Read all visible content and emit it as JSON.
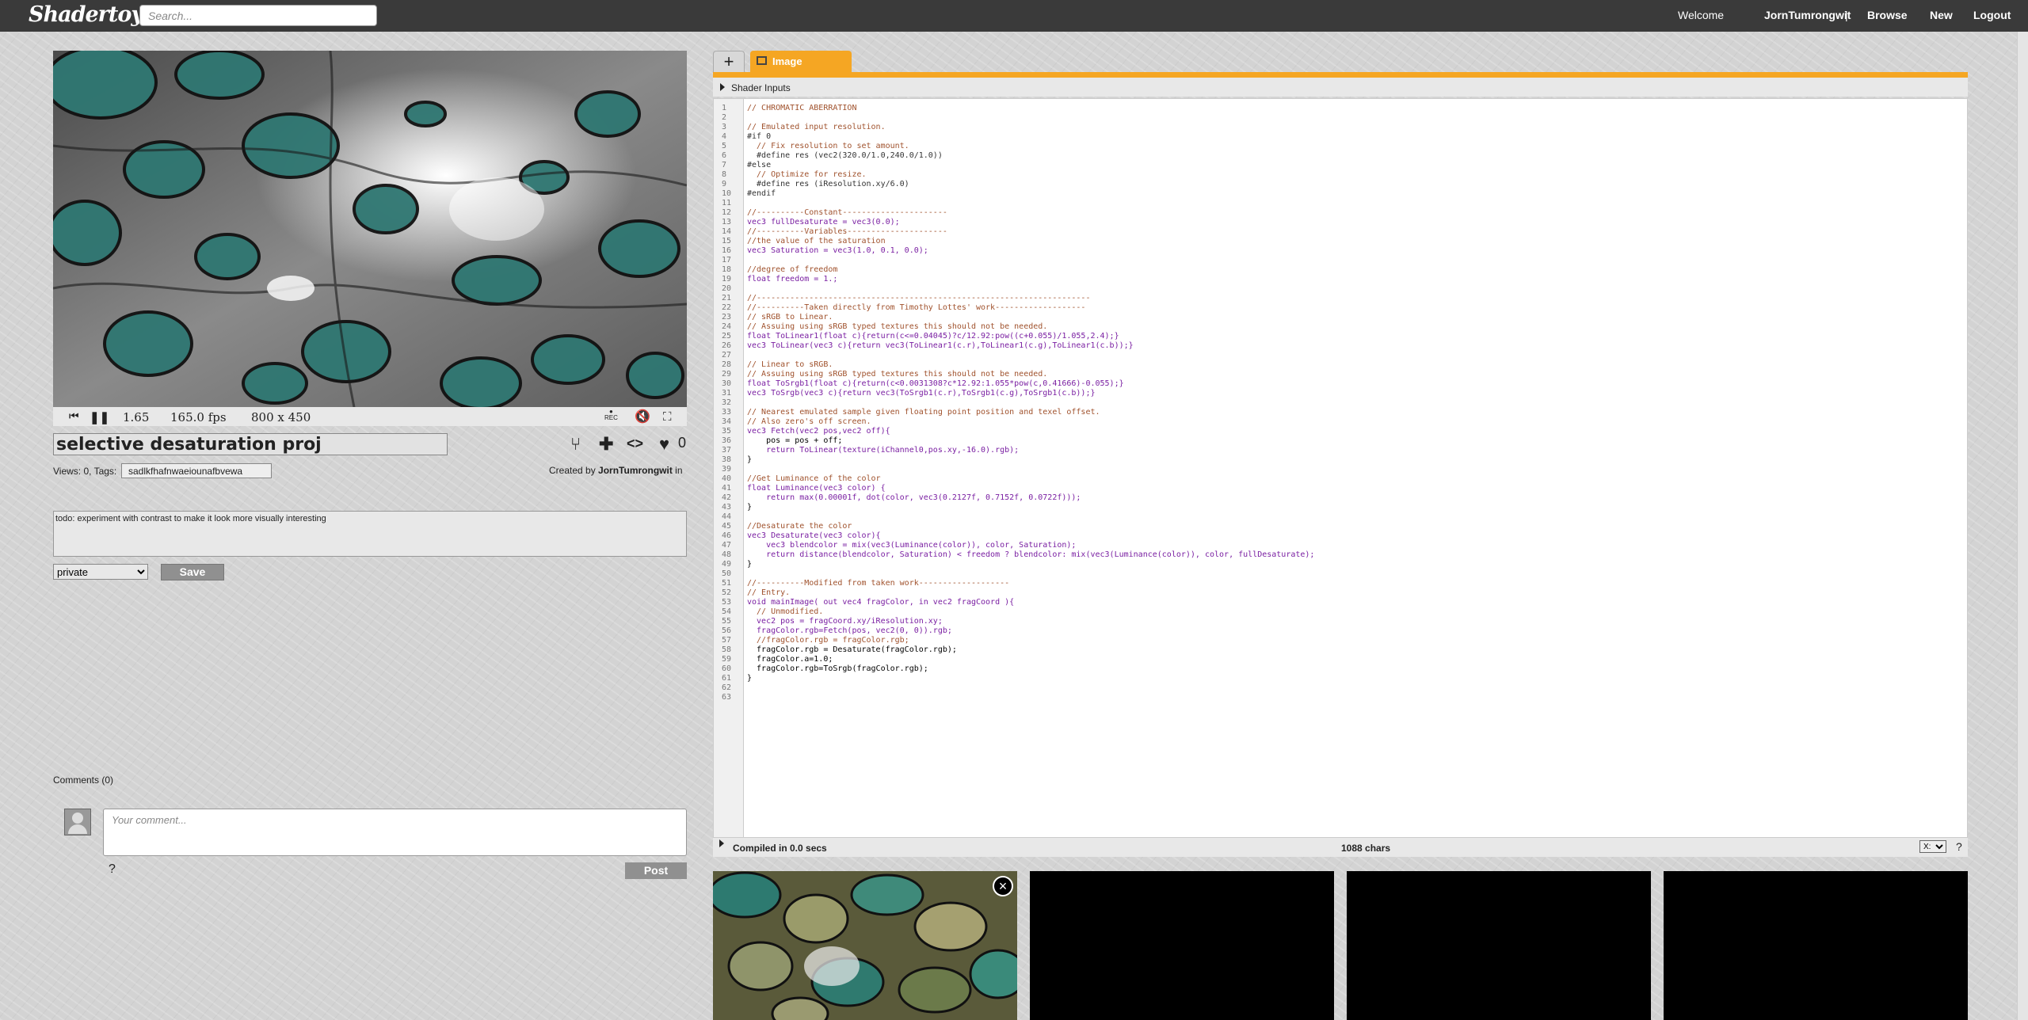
{
  "header": {
    "logo": "Shadertoy",
    "search_placeholder": "Search...",
    "welcome": "Welcome",
    "username": "JornTumrongwit",
    "separator": "|",
    "browse": "Browse",
    "new": "New",
    "logout": "Logout"
  },
  "player": {
    "time": "1.65",
    "fps": "165.0 fps",
    "resolution": "800 x 450",
    "rec_label": "REC"
  },
  "shader": {
    "title": "selective desaturation proj",
    "likes": "0",
    "views": "Views: 0, Tags:",
    "tags": "sadlkfhafnwaeiounafbvewa",
    "created_by": "Created by",
    "author": "JornTumrongwit",
    "in": "in",
    "description": "todo: experiment with contrast to make it look more visually interesting",
    "privacy": "private",
    "privacy_options": [
      "private"
    ],
    "save": "Save"
  },
  "comments": {
    "label": "Comments (0)",
    "placeholder": "Your comment...",
    "help": "?",
    "post": "Post"
  },
  "editor": {
    "add_tab": "+",
    "tab_image": "Image",
    "shader_inputs": "Shader Inputs",
    "status": "Compiled in 0.0 secs",
    "chars": "1088 chars",
    "select_value": "X:",
    "help": "?",
    "lines": [
      "// CHROMATIC ABERRATION",
      "",
      "// Emulated input resolution.",
      "#if 0",
      "  // Fix resolution to set amount.",
      "  #define res (vec2(320.0/1.0,240.0/1.0))",
      "#else",
      "  // Optimize for resize.",
      "  #define res (iResolution.xy/6.0)",
      "#endif",
      "",
      "//----------Constant----------------------",
      "vec3 fullDesaturate = vec3(0.0);",
      "//----------Variables---------------------",
      "//the value of the saturation",
      "vec3 Saturation = vec3(1.0, 0.1, 0.0);",
      "",
      "//degree of freedom",
      "float freedom = 1.;",
      "",
      "//----------------------------------------------------------------------",
      "//----------Taken directly from Timothy Lottes' work-------------------",
      "// sRGB to Linear.",
      "// Assuing using sRGB typed textures this should not be needed.",
      "float ToLinear1(float c){return(c<=0.04045)?c/12.92:pow((c+0.055)/1.055,2.4);}",
      "vec3 ToLinear(vec3 c){return vec3(ToLinear1(c.r),ToLinear1(c.g),ToLinear1(c.b));}",
      "",
      "// Linear to sRGB.",
      "// Assuing using sRGB typed textures this should not be needed.",
      "float ToSrgb1(float c){return(c<0.0031308?c*12.92:1.055*pow(c,0.41666)-0.055);}",
      "vec3 ToSrgb(vec3 c){return vec3(ToSrgb1(c.r),ToSrgb1(c.g),ToSrgb1(c.b));}",
      "",
      "// Nearest emulated sample given floating point position and texel offset.",
      "// Also zero's off screen.",
      "vec3 Fetch(vec2 pos,vec2 off){",
      "    pos = pos + off;",
      "    return ToLinear(texture(iChannel0,pos.xy,-16.0).rgb);",
      "}",
      "",
      "//Get Luminance of the color",
      "float Luminance(vec3 color) {",
      "    return max(0.00001f, dot(color, vec3(0.2127f, 0.7152f, 0.0722f)));",
      "}",
      "",
      "//Desaturate the color",
      "vec3 Desaturate(vec3 color){",
      "    vec3 blendcolor = mix(vec3(Luminance(color)), color, Saturation);",
      "    return distance(blendcolor, Saturation) < freedom ? blendcolor: mix(vec3(Luminance(color)), color, fullDesaturate);",
      "}",
      "",
      "//----------Modified from taken work-------------------",
      "// Entry.",
      "void mainImage( out vec4 fragColor, in vec2 fragCoord ){",
      "  // Unmodified.",
      "  vec2 pos = fragCoord.xy/iResolution.xy;",
      "  fragColor.rgb=Fetch(pos, vec2(0, 0)).rgb;",
      "  //fragColor.rgb = fragColor.rgb;",
      "  fragColor.rgb = Desaturate(fragColor.rgb);",
      "  fragColor.a=1.0;",
      "  fragColor.rgb=ToSrgb(fragColor.rgb);",
      "}",
      "",
      ""
    ]
  },
  "channels": {
    "close": "×"
  },
  "colors": {
    "topbar": "#3a3a3a",
    "accent": "#f5a623",
    "comment": "#a0522d",
    "keyword": "#7a1fa2",
    "teal": "#3b8a86"
  }
}
